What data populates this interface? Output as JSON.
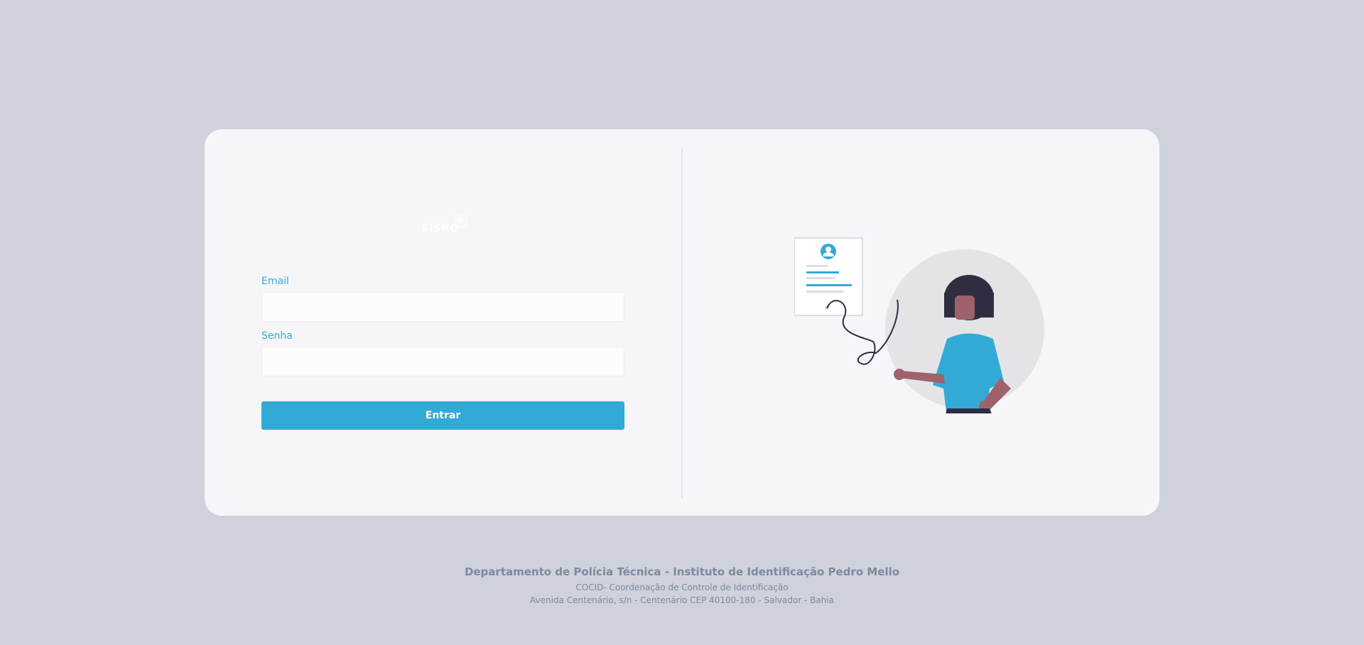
{
  "logo": {
    "text": "SISRG",
    "icon": "fingerprint-icon"
  },
  "form": {
    "email": {
      "label": "Email",
      "value": "",
      "placeholder": ""
    },
    "senha": {
      "label": "Senha",
      "value": "",
      "placeholder": ""
    },
    "submit_label": "Entrar"
  },
  "illustration": {
    "icon": "person-holding-document-illustration"
  },
  "footer": {
    "title": "Departamento de Polícia Técnica - Instituto de Identificação Pedro Mello",
    "line1": "COCID- Coordenação de Controle de Identificação",
    "line2": "Avenida Centenário, s/n - Centenário CEP 40100-180 - Salvador - Bahia"
  },
  "colors": {
    "background": "#cfd1dc",
    "card": "#f6f6fa",
    "accent": "#33aad5",
    "footer_text": "#7d8aa0"
  }
}
